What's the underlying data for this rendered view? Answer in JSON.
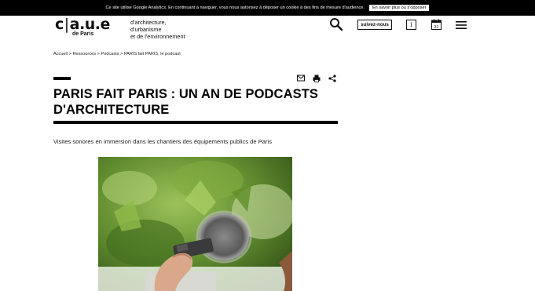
{
  "cookie_banner": {
    "message": "Ce site utilise Google Analytics. En continuant à naviguer, vous nous autorisez à déposer un cookie à des fins de mesure d'audience.",
    "button_label": "En savoir plus ou s'opposer"
  },
  "logo": {
    "part1": "c",
    "part2": "a.u.e",
    "subtitle": "de Paris"
  },
  "tagline": {
    "line1": "d'architecture,",
    "line2": "d'urbanisme",
    "line3": "et de l'environnement"
  },
  "header": {
    "follow_label": "suivez-nous",
    "info_label": "i",
    "calendar_day": "31"
  },
  "breadcrumb": {
    "items": [
      "Accueil",
      "Ressources",
      "Podcasts",
      "PARIS fait PARIS, le podcast"
    ],
    "separator": ">"
  },
  "article": {
    "title": "PARIS FAIT PARIS : UN AN DE PODCASTS D'ARCHITECTURE",
    "subtitle": "Visites sonores en immersion dans les chantiers des équipements publics de Paris"
  },
  "colors": {
    "text": "#000000",
    "banner_bg": "#000000",
    "photo_green": "#6e9a3c"
  },
  "icons": [
    "search-icon",
    "info-icon",
    "calendar-icon",
    "menu-icon",
    "email-icon",
    "print-icon",
    "share-icon"
  ]
}
